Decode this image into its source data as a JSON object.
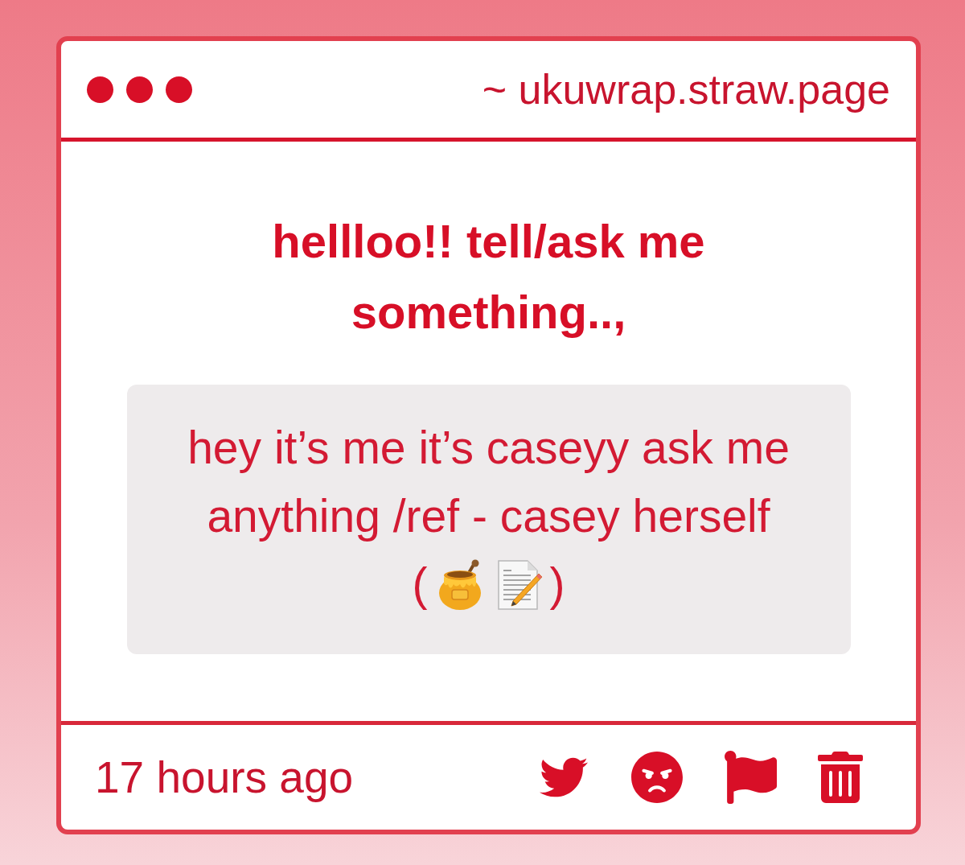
{
  "window": {
    "address": "~ ukuwrap.straw.page"
  },
  "prompt": {
    "title": "hellloo!! tell/ask me something..,"
  },
  "message": {
    "text": "hey it’s me it’s caseyy ask me anything /ref - casey herself",
    "closing": {
      "open": "(",
      "emojis": [
        {
          "kind": "honey_pot"
        },
        {
          "kind": "memo"
        }
      ],
      "close": ")"
    }
  },
  "footer": {
    "time": "17 hours ago"
  }
}
